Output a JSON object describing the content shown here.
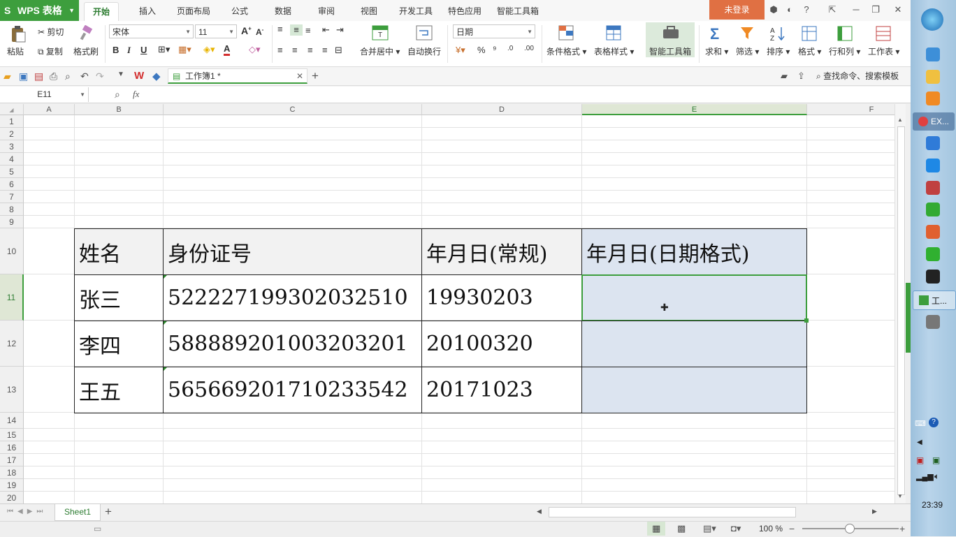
{
  "app": {
    "name": "WPS 表格"
  },
  "menu_tabs": [
    "开始",
    "插入",
    "页面布局",
    "公式",
    "数据",
    "审阅",
    "视图",
    "开发工具",
    "特色应用",
    "智能工具箱"
  ],
  "login": "未登录",
  "ribbon": {
    "paste": "粘贴",
    "cut": "剪切",
    "copy": "复制",
    "format_painter": "格式刷",
    "font_name": "宋体",
    "font_size": "11",
    "merge_center": "合并居中",
    "wrap_text": "自动换行",
    "number_format": "日期",
    "cond_format": "条件格式",
    "table_style": "表格样式",
    "smart_toolbox": "智能工具箱",
    "sum": "求和",
    "filter": "筛选",
    "sort": "排序",
    "format": "格式",
    "row_col": "行和列",
    "worksheet": "工作表"
  },
  "doc_tab": {
    "title": "工作簿1 *"
  },
  "search_cmd": "查找命令、搜索模板",
  "formula_bar": {
    "name_box": "E11",
    "fx": "fx",
    "formula": ""
  },
  "columns": [
    "A",
    "B",
    "C",
    "D",
    "E",
    "F"
  ],
  "rows": [
    "1",
    "2",
    "3",
    "4",
    "5",
    "6",
    "7",
    "8",
    "9",
    "10",
    "11",
    "12",
    "13",
    "14",
    "15",
    "16",
    "17",
    "18",
    "19",
    "20"
  ],
  "table": {
    "headers": [
      "姓名",
      "身份证号",
      "年月日(常规)",
      "年月日(日期格式)"
    ],
    "rows": [
      [
        "张三",
        "522227199302032510",
        "19930203",
        ""
      ],
      [
        "李四",
        "588889201003203201",
        "20100320",
        ""
      ],
      [
        "王五",
        "565669201710233542",
        "20171023",
        ""
      ]
    ]
  },
  "sheet_tabs": [
    "Sheet1"
  ],
  "status": {
    "zoom": "100 %"
  },
  "taskbar": {
    "tasks": [
      "EX...",
      "工..."
    ],
    "time": "23:39"
  },
  "colors": {
    "accent": "#3d9e3d",
    "login": "#e07043",
    "selected_col": "#dce4f0"
  }
}
